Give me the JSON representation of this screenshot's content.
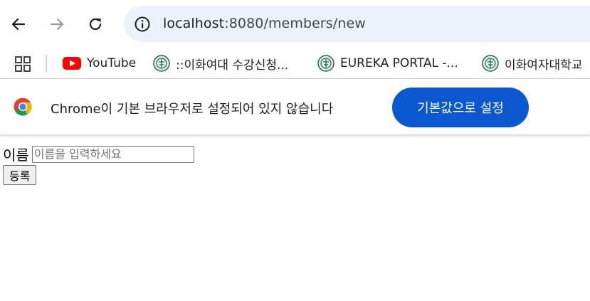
{
  "browser": {
    "url_host": "localhost",
    "url_path": ":8080/members/new",
    "icons": {
      "back": "arrow-left-icon",
      "forward": "arrow-right-icon",
      "reload": "reload-icon",
      "site_info": "info-circle-icon"
    }
  },
  "bookmarks": [
    {
      "label": "YouTube",
      "icon": "youtube-icon"
    },
    {
      "label": "::이화여대 수강신청...",
      "icon": "ewha-emblem-icon"
    },
    {
      "label": "EUREKA PORTAL -...",
      "icon": "ewha-emblem-icon"
    },
    {
      "label": "이화여자대학교",
      "icon": "ewha-emblem-icon"
    }
  ],
  "infobar": {
    "message": "Chrome이 기본 브라우저로 설정되어 있지 않습니다",
    "button_label": "기본값으로 설정",
    "accent_color": "#0b57d0"
  },
  "form": {
    "name_label": "이름",
    "name_placeholder": "이름을 입력하세요",
    "name_value": "",
    "submit_label": "등록"
  }
}
